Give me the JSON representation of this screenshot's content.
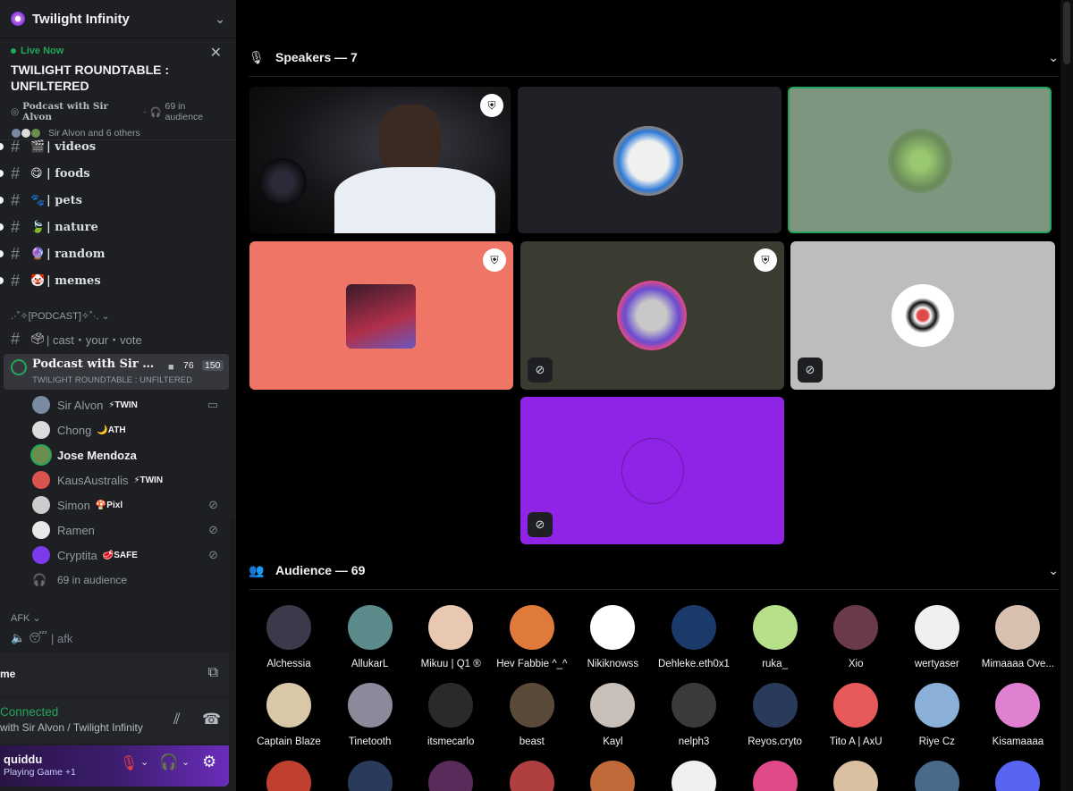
{
  "server": {
    "name": "Twilight Infinity"
  },
  "live": {
    "status": "Live Now",
    "title": "TWILIGHT ROUNDTABLE : UNFILTERED",
    "stage": "Podcast with Sir Alvon",
    "audience": "69 in audience",
    "speakers_summary": "Sir Alvon and 6 others"
  },
  "channels": [
    {
      "emoji": "🎬",
      "name": "videos"
    },
    {
      "emoji": "😋",
      "name": "foods"
    },
    {
      "emoji": "🐾",
      "name": "pets"
    },
    {
      "emoji": "🍃",
      "name": "nature"
    },
    {
      "emoji": "🔮",
      "name": "random"
    },
    {
      "emoji": "🤡",
      "name": "memes"
    }
  ],
  "podcast_category": ".·˚✧[PODCAST]✧˚·.",
  "vote_channel": {
    "emoji": "🗳",
    "name": "cast・your・vote"
  },
  "stage_channel": {
    "name": "Podcast with Sir Al...",
    "topic": "TWILIGHT ROUNDTABLE : UNFILTERED",
    "count": "76",
    "capacity": "150"
  },
  "stage_users": [
    {
      "name": "Sir Alvon",
      "tag": "⚡TWIN",
      "color": "#7a8aa0",
      "right_icon": "camera-icon",
      "right": "▭"
    },
    {
      "name": "Chong",
      "tag": "🌙ATH",
      "color": "#dcdcdc",
      "right_icon": "",
      "right": ""
    },
    {
      "name": "Jose Mendoza",
      "tag": "",
      "color": "#6b8e4e",
      "right_icon": "",
      "right": "",
      "highlight": true
    },
    {
      "name": "KausAustralis",
      "tag": "⚡TWIN",
      "color": "#d9534f",
      "right_icon": "",
      "right": ""
    },
    {
      "name": "Simon",
      "tag": "🍄Pixl",
      "color": "#cccccc",
      "right_icon": "mic-muted-icon",
      "right": "⊘"
    },
    {
      "name": "Ramen",
      "tag": "",
      "color": "#e8e8e8",
      "right_icon": "mic-muted-icon",
      "right": "⊘"
    },
    {
      "name": "Cryptita",
      "tag": "🥩SAFE",
      "color": "#7c3aed",
      "right_icon": "mic-muted-icon",
      "right": "⊘"
    }
  ],
  "stage_audience": "69 in audience",
  "afk_category": "AFK",
  "afk_channel": {
    "emoji": "😴",
    "name": "afk"
  },
  "panel1_name": "me",
  "voice_status": {
    "connected": "Connected",
    "channel": "with Sir Alvon / Twilight Infinity"
  },
  "user": {
    "name": "quiddu",
    "activity": "Playing Game +1"
  },
  "speakers_header": "Speakers — 7",
  "audience_header": "Audience — 69",
  "speakers": [
    {
      "kind": "video",
      "bg": "#0b0b0d",
      "badge": true,
      "muted": false
    },
    {
      "kind": "avatar",
      "bg": "#1f2126",
      "badge": false,
      "muted": false,
      "avatar": "#1a2a5a"
    },
    {
      "kind": "avatar",
      "bg": "#7e9680",
      "badge": false,
      "muted": false,
      "avatar": "#6a8a5a",
      "speaking": true
    },
    {
      "kind": "avatar",
      "bg": "#ef7666",
      "badge": true,
      "muted": false,
      "avatar": "#c0424e"
    },
    {
      "kind": "avatar",
      "bg": "#3a3b31",
      "badge": true,
      "muted": true,
      "avatar": "#6a4bd0"
    },
    {
      "kind": "avatar",
      "bg": "#bdbdbd",
      "badge": false,
      "muted": true,
      "avatar": "#ffffff"
    },
    {
      "kind": "avatar",
      "bg": "#8f23e6",
      "badge": false,
      "muted": true,
      "avatar": "#8f23e6"
    }
  ],
  "audience": [
    {
      "name": "Alchessia",
      "color": "#3a3a4a"
    },
    {
      "name": "AllukarL",
      "color": "#5a8a8a"
    },
    {
      "name": "Mikuu | Q1 ®",
      "color": "#e8c8b0"
    },
    {
      "name": "Hev Fabbie ^_^",
      "color": "#e07a3a"
    },
    {
      "name": "Nikiknowss",
      "color": "#ffffff"
    },
    {
      "name": "Dehleke.eth0x1",
      "color": "#1a3a6a"
    },
    {
      "name": "ruka_",
      "color": "#b8e08a"
    },
    {
      "name": "Xio",
      "color": "#6a3a4a"
    },
    {
      "name": "wertyaser",
      "color": "#f0f0f0"
    },
    {
      "name": "Mimaaaa Ove...",
      "color": "#d8c0b0"
    },
    {
      "name": "Captain Blaze",
      "color": "#d8c8a8"
    },
    {
      "name": "Tinetooth",
      "color": "#8a8a9a"
    },
    {
      "name": "itsmecarlo",
      "color": "#2a2a2a"
    },
    {
      "name": "beast",
      "color": "#5a4a3a"
    },
    {
      "name": "Kayl",
      "color": "#c8c0b8"
    },
    {
      "name": "nelph3",
      "color": "#3a3a3a"
    },
    {
      "name": "Reyos.cryto",
      "color": "#2a3a5a"
    },
    {
      "name": "Tito A | AxU",
      "color": "#e85a5a"
    },
    {
      "name": "Riye Cz",
      "color": "#8ab0d8"
    },
    {
      "name": "Kisamaaaa",
      "color": "#e080d0"
    },
    {
      "name": "",
      "color": "#c04030"
    },
    {
      "name": "",
      "color": "#2a3a5a"
    },
    {
      "name": "",
      "color": "#5a2a5a"
    },
    {
      "name": "",
      "color": "#b04040"
    },
    {
      "name": "",
      "color": "#c06a3a"
    },
    {
      "name": "",
      "color": "#f0f0f0"
    },
    {
      "name": "",
      "color": "#e04a8a"
    },
    {
      "name": "",
      "color": "#d8c0a0"
    },
    {
      "name": "",
      "color": "#4a6a8a"
    },
    {
      "name": "",
      "color": "#5865f2"
    }
  ]
}
